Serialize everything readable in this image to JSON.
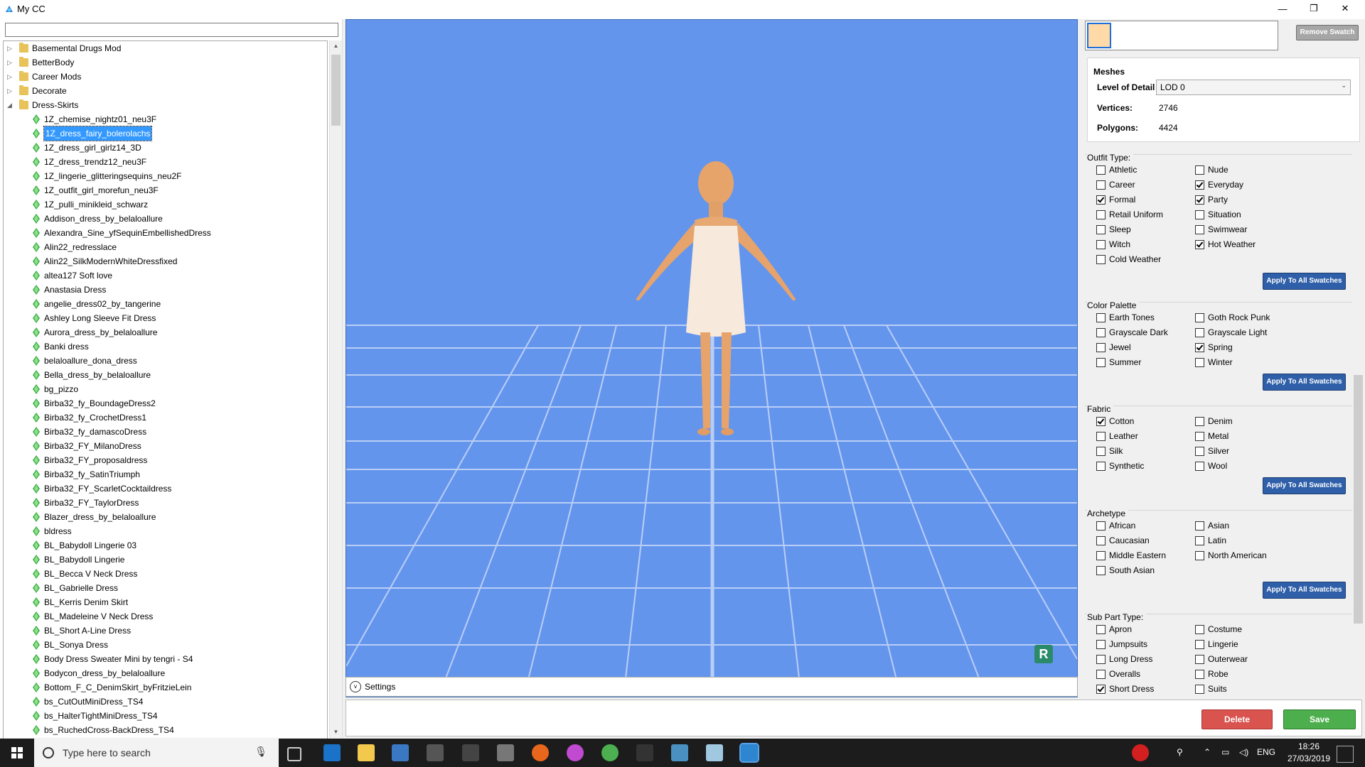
{
  "window": {
    "title": "My CC",
    "minimize": "—",
    "maximize": "❐",
    "close": "✕"
  },
  "tree": {
    "folders": [
      "Basemental Drugs Mod",
      "BetterBody",
      "Career Mods",
      "Decorate",
      "Dress-Skirts"
    ],
    "items": [
      "1Z_chemise_nightz01_neu3F",
      "1Z_dress_fairy_bolerolachs",
      "1Z_dress_girl_girlz14_3D",
      "1Z_dress_trendz12_neu3F",
      "1Z_lingerie_glitteringsequins_neu2F",
      "1Z_outfit_girl_morefun_neu3F",
      "1Z_pulli_minikleid_schwarz",
      "Addison_dress_by_belaloallure",
      "Alexandra_Sine_yfSequinEmbellishedDress",
      "Alin22_redresslace",
      "Alin22_SilkModernWhiteDressfixed",
      "altea127 Soft love",
      "Anastasia Dress",
      "angelie_dress02_by_tangerine",
      "Ashley Long Sleeve Fit Dress",
      "Aurora_dress_by_belaloallure",
      "Banki dress",
      "belaloallure_dona_dress",
      "Bella_dress_by_belaloallure",
      "bg_pizzo",
      "Birba32_fy_BoundageDress2",
      "Birba32_fy_CrochetDress1",
      "Birba32_fy_damascoDress",
      "Birba32_FY_MilanoDress",
      "Birba32_FY_proposaldress",
      "Birba32_fy_SatinTriumph",
      "Birba32_FY_ScarletCocktaildress",
      "Birba32_FY_TaylorDress",
      "Blazer_dress_by_belaloallure",
      "bldress",
      "BL_Babydoll Lingerie 03",
      "BL_Babydoll Lingerie",
      "BL_Becca V Neck Dress",
      "BL_Gabrielle Dress",
      "BL_Kerris Denim Skirt",
      "BL_Madeleine V Neck Dress",
      "BL_Short A-Line Dress",
      "BL_Sonya Dress",
      "Body Dress Sweater Mini by tengri - S4",
      "Bodycon_dress_by_belaloallure",
      "Bottom_F_C_DenimSkirt_byFritzieLein",
      "bs_CutOutMiniDress_TS4",
      "bs_HalterTightMiniDress_TS4",
      "bs_RuchedCross-BackDress_TS4"
    ],
    "selected_index": 1
  },
  "viewport": {
    "settings_label": "Settings",
    "badge_letter": "R"
  },
  "swatch": {
    "remove_label": "Remove Swatch"
  },
  "meshes": {
    "heading": "Meshes",
    "lod_label": "Level of Detail",
    "lod_value": "LOD 0",
    "vertices_label": "Vertices:",
    "vertices_value": "2746",
    "polygons_label": "Polygons:",
    "polygons_value": "4424"
  },
  "apply_label": "Apply To All Swatches",
  "outfit": {
    "title": "Outfit Type:",
    "left": [
      {
        "label": "Athletic",
        "checked": false
      },
      {
        "label": "Career",
        "checked": false
      },
      {
        "label": "Formal",
        "checked": true
      },
      {
        "label": "Retail Uniform",
        "checked": false
      },
      {
        "label": "Sleep",
        "checked": false
      },
      {
        "label": "Witch",
        "checked": false
      },
      {
        "label": "Cold Weather",
        "checked": false
      }
    ],
    "right": [
      {
        "label": "Nude",
        "checked": false
      },
      {
        "label": "Everyday",
        "checked": true
      },
      {
        "label": "Party",
        "checked": true
      },
      {
        "label": "Situation",
        "checked": false
      },
      {
        "label": "Swimwear",
        "checked": false
      },
      {
        "label": "Hot Weather",
        "checked": true
      }
    ]
  },
  "palette": {
    "title": "Color Palette",
    "left": [
      {
        "label": "Earth Tones",
        "checked": false
      },
      {
        "label": "Grayscale Dark",
        "checked": false
      },
      {
        "label": "Jewel",
        "checked": false
      },
      {
        "label": "Summer",
        "checked": false
      }
    ],
    "right": [
      {
        "label": "Goth Rock Punk",
        "checked": false
      },
      {
        "label": "Grayscale Light",
        "checked": false
      },
      {
        "label": "Spring",
        "checked": true
      },
      {
        "label": "Winter",
        "checked": false
      }
    ]
  },
  "fabric": {
    "title": "Fabric",
    "left": [
      {
        "label": "Cotton",
        "checked": true
      },
      {
        "label": "Leather",
        "checked": false
      },
      {
        "label": "Silk",
        "checked": false
      },
      {
        "label": "Synthetic",
        "checked": false
      }
    ],
    "right": [
      {
        "label": "Denim",
        "checked": false
      },
      {
        "label": "Metal",
        "checked": false
      },
      {
        "label": "Silver",
        "checked": false
      },
      {
        "label": "Wool",
        "checked": false
      }
    ]
  },
  "archetype": {
    "title": "Archetype",
    "left": [
      {
        "label": "African",
        "checked": false
      },
      {
        "label": "Caucasian",
        "checked": false
      },
      {
        "label": "Middle Eastern",
        "checked": false
      },
      {
        "label": "South Asian",
        "checked": false
      }
    ],
    "right": [
      {
        "label": "Asian",
        "checked": false
      },
      {
        "label": "Latin",
        "checked": false
      },
      {
        "label": "North American",
        "checked": false
      }
    ]
  },
  "subpart": {
    "title": "Sub Part Type:",
    "left": [
      {
        "label": "Apron",
        "checked": false
      },
      {
        "label": "Jumpsuits",
        "checked": false
      },
      {
        "label": "Long Dress",
        "checked": false
      },
      {
        "label": "Overalls",
        "checked": false
      },
      {
        "label": "Short Dress",
        "checked": true
      }
    ],
    "right": [
      {
        "label": "Costume",
        "checked": false
      },
      {
        "label": "Lingerie",
        "checked": false
      },
      {
        "label": "Outerwear",
        "checked": false
      },
      {
        "label": "Robe",
        "checked": false
      },
      {
        "label": "Suits",
        "checked": false
      }
    ]
  },
  "actions": {
    "delete_label": "Delete",
    "save_label": "Save"
  },
  "taskbar": {
    "search_placeholder": "Type here to search",
    "language": "ENG",
    "time": "18:26",
    "date": "27/03/2019"
  }
}
